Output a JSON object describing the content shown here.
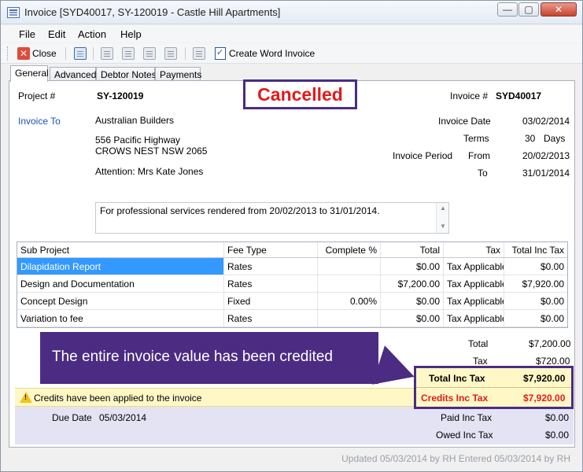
{
  "window": {
    "title": "Invoice [SYD40017, SY-120019 - Castle Hill Apartments]",
    "controls": {
      "minimize": "—",
      "maximize": "▢",
      "close": "✕"
    }
  },
  "menu": [
    "File",
    "Edit",
    "Action",
    "Help"
  ],
  "toolbar": {
    "close_label": "Close",
    "create_word_label": "Create Word Invoice",
    "icons": [
      "close-icon",
      "table-icon",
      "report-icon",
      "report-icon",
      "edit-icon",
      "print-icon",
      "attach-icon",
      "word-icon"
    ]
  },
  "tabs": [
    "General",
    "Advanced",
    "Debtor Notes",
    "Payments"
  ],
  "invoice": {
    "project_label": "Project #",
    "project_value": "SY-120019",
    "status": "Cancelled",
    "invoice_no_label": "Invoice #",
    "invoice_no_value": "SYD40017",
    "invoice_to_label": "Invoice To",
    "client_name": "Australian Builders",
    "address_line1": "556 Pacific Highway",
    "address_line2": "CROWS NEST  NSW  2065",
    "attention": "Attention: Mrs Kate Jones",
    "invoice_date_label": "Invoice Date",
    "invoice_date_value": "03/02/2014",
    "terms_label": "Terms",
    "terms_value": "30",
    "terms_unit": "Days",
    "period_label": "Invoice Period",
    "from_label": "From",
    "from_value": "20/02/2013",
    "to_label": "To",
    "to_value": "31/01/2014",
    "description": "For professional services rendered from 20/02/2013 to 31/01/2014."
  },
  "grid": {
    "headers": [
      "Sub Project",
      "Fee Type",
      "Complete %",
      "Total",
      "Tax",
      "Total Inc Tax"
    ],
    "rows": [
      [
        "Dilapidation Report",
        "Rates",
        "",
        "$0.00",
        "Tax Applicable",
        "$0.00"
      ],
      [
        "Design and Documentation",
        "Rates",
        "",
        "$7,200.00",
        "Tax Applicable",
        "$7,920.00"
      ],
      [
        "Concept Design",
        "Fixed",
        "0.00%",
        "$0.00",
        "Tax Applicable",
        "$0.00"
      ],
      [
        "Variation to fee",
        "Rates",
        "",
        "$0.00",
        "Tax Applicable",
        "$0.00"
      ]
    ]
  },
  "callout": "The entire invoice value has been credited",
  "notice": "Credits have been applied to the invoice",
  "totals": {
    "total_label": "Total",
    "total_value": "$7,200.00",
    "tax_label": "Tax",
    "tax_value": "$720.00",
    "total_inc_label": "Total Inc Tax",
    "total_inc_value": "$7,920.00",
    "credits_label": "Credits Inc Tax",
    "credits_value": "$7,920.00",
    "paid_label": "Paid Inc Tax",
    "paid_value": "$0.00",
    "owed_label": "Owed Inc Tax",
    "owed_value": "$0.00"
  },
  "due": {
    "label": "Due Date",
    "value": "05/03/2014"
  },
  "status_bar": "Updated 05/03/2014 by RH   Entered 05/03/2014 by RH",
  "colors": {
    "accent_purple": "#4b2c82",
    "cancelled_red": "#e21a1a",
    "selection_blue": "#3399ff",
    "notice_yellow": "#fff8c6",
    "lower_band": "#e3e3f4"
  }
}
